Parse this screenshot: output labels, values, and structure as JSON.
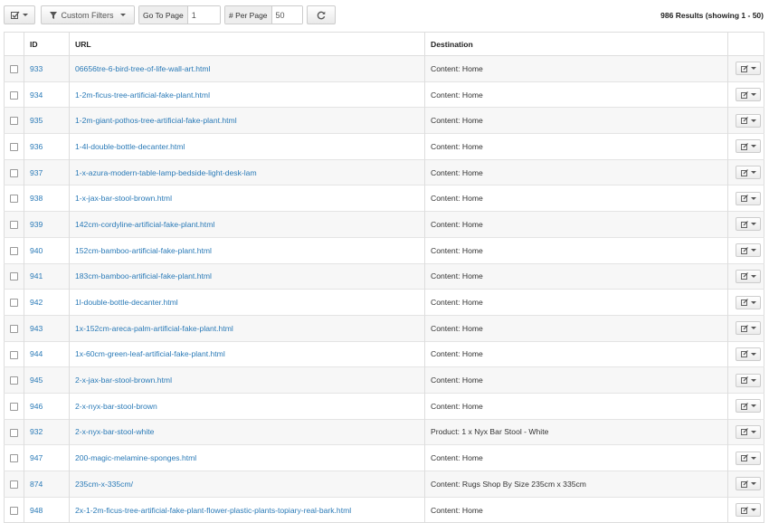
{
  "toolbar": {
    "filters_label": "Custom Filters",
    "goto_label": "Go To Page",
    "goto_value": "1",
    "perpage_label": "# Per Page",
    "perpage_value": "50",
    "results": "986 Results (showing 1 - 50)"
  },
  "columns": {
    "id": "ID",
    "url": "URL",
    "destination": "Destination"
  },
  "rows": [
    {
      "id": "933",
      "url": "06656tre-6-bird-tree-of-life-wall-art.html",
      "destination": "Content: Home"
    },
    {
      "id": "934",
      "url": "1-2m-ficus-tree-artificial-fake-plant.html",
      "destination": "Content: Home"
    },
    {
      "id": "935",
      "url": "1-2m-giant-pothos-tree-artificial-fake-plant.html",
      "destination": "Content: Home"
    },
    {
      "id": "936",
      "url": "1-4l-double-bottle-decanter.html",
      "destination": "Content: Home"
    },
    {
      "id": "937",
      "url": "1-x-azura-modern-table-lamp-bedside-light-desk-lam",
      "destination": "Content: Home"
    },
    {
      "id": "938",
      "url": "1-x-jax-bar-stool-brown.html",
      "destination": "Content: Home"
    },
    {
      "id": "939",
      "url": "142cm-cordyline-artificial-fake-plant.html",
      "destination": "Content: Home"
    },
    {
      "id": "940",
      "url": "152cm-bamboo-artificial-fake-plant.html",
      "destination": "Content: Home"
    },
    {
      "id": "941",
      "url": "183cm-bamboo-artificial-fake-plant.html",
      "destination": "Content: Home"
    },
    {
      "id": "942",
      "url": "1l-double-bottle-decanter.html",
      "destination": "Content: Home"
    },
    {
      "id": "943",
      "url": "1x-152cm-areca-palm-artificial-fake-plant.html",
      "destination": "Content: Home"
    },
    {
      "id": "944",
      "url": "1x-60cm-green-leaf-artificial-fake-plant.html",
      "destination": "Content: Home"
    },
    {
      "id": "945",
      "url": "2-x-jax-bar-stool-brown.html",
      "destination": "Content: Home"
    },
    {
      "id": "946",
      "url": "2-x-nyx-bar-stool-brown",
      "destination": "Content: Home"
    },
    {
      "id": "932",
      "url": "2-x-nyx-bar-stool-white",
      "destination": "Product: 1 x Nyx Bar Stool - White"
    },
    {
      "id": "947",
      "url": "200-magic-melamine-sponges.html",
      "destination": "Content: Home"
    },
    {
      "id": "874",
      "url": "235cm-x-335cm/",
      "destination": "Content: Rugs Shop By Size 235cm x 335cm"
    },
    {
      "id": "948",
      "url": "2x-1-2m-ficus-tree-artificial-fake-plant-flower-plastic-plants-topiary-real-bark.html",
      "destination": "Content: Home"
    }
  ]
}
